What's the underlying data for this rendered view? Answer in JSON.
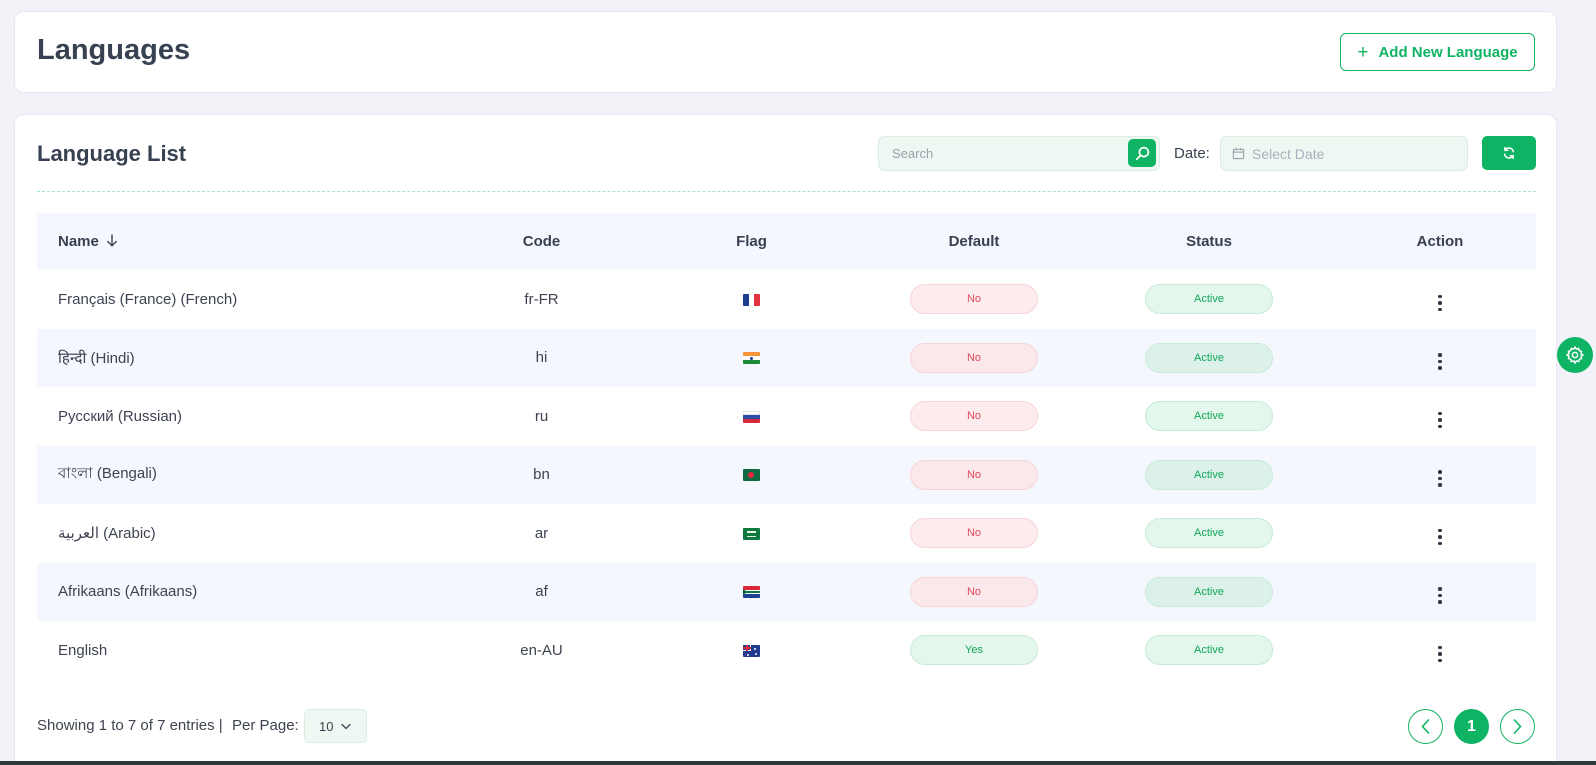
{
  "header": {
    "title": "Languages",
    "add_button_label": "Add New Language",
    "add_button_icon": "plus-icon"
  },
  "list": {
    "title": "Language List",
    "search_placeholder": "Search",
    "date_label": "Date:",
    "date_placeholder": "Select Date",
    "columns": {
      "name": "Name",
      "code": "Code",
      "flag": "Flag",
      "default": "Default",
      "status": "Status",
      "action": "Action"
    },
    "sort": {
      "column": "name",
      "direction": "descending-arrow"
    },
    "rows": [
      {
        "name": "Français (France) (French)",
        "code": "fr-FR",
        "flag": "fr",
        "default": "No",
        "status": "Active"
      },
      {
        "name": "हिन्दी (Hindi)",
        "code": "hi",
        "flag": "in",
        "default": "No",
        "status": "Active"
      },
      {
        "name": "Русский (Russian)",
        "code": "ru",
        "flag": "ru",
        "default": "No",
        "status": "Active"
      },
      {
        "name": "বাংলা (Bengali)",
        "code": "bn",
        "flag": "bd",
        "default": "No",
        "status": "Active"
      },
      {
        "name": "العربية (Arabic)",
        "code": "ar",
        "flag": "sa",
        "default": "No",
        "status": "Active"
      },
      {
        "name": "Afrikaans (Afrikaans)",
        "code": "af",
        "flag": "za",
        "default": "No",
        "status": "Active"
      },
      {
        "name": "English",
        "code": "en-AU",
        "flag": "au",
        "default": "Yes",
        "status": "Active"
      }
    ]
  },
  "footer": {
    "showing_text": "Showing 1 to 7 of 7 entries |",
    "per_page_label": "Per Page:",
    "per_page_value": "10",
    "current_page": "1"
  },
  "colors": {
    "accent": "#0fb364",
    "badge_no_text": "#e0485a",
    "badge_yes_text": "#12a75a"
  }
}
